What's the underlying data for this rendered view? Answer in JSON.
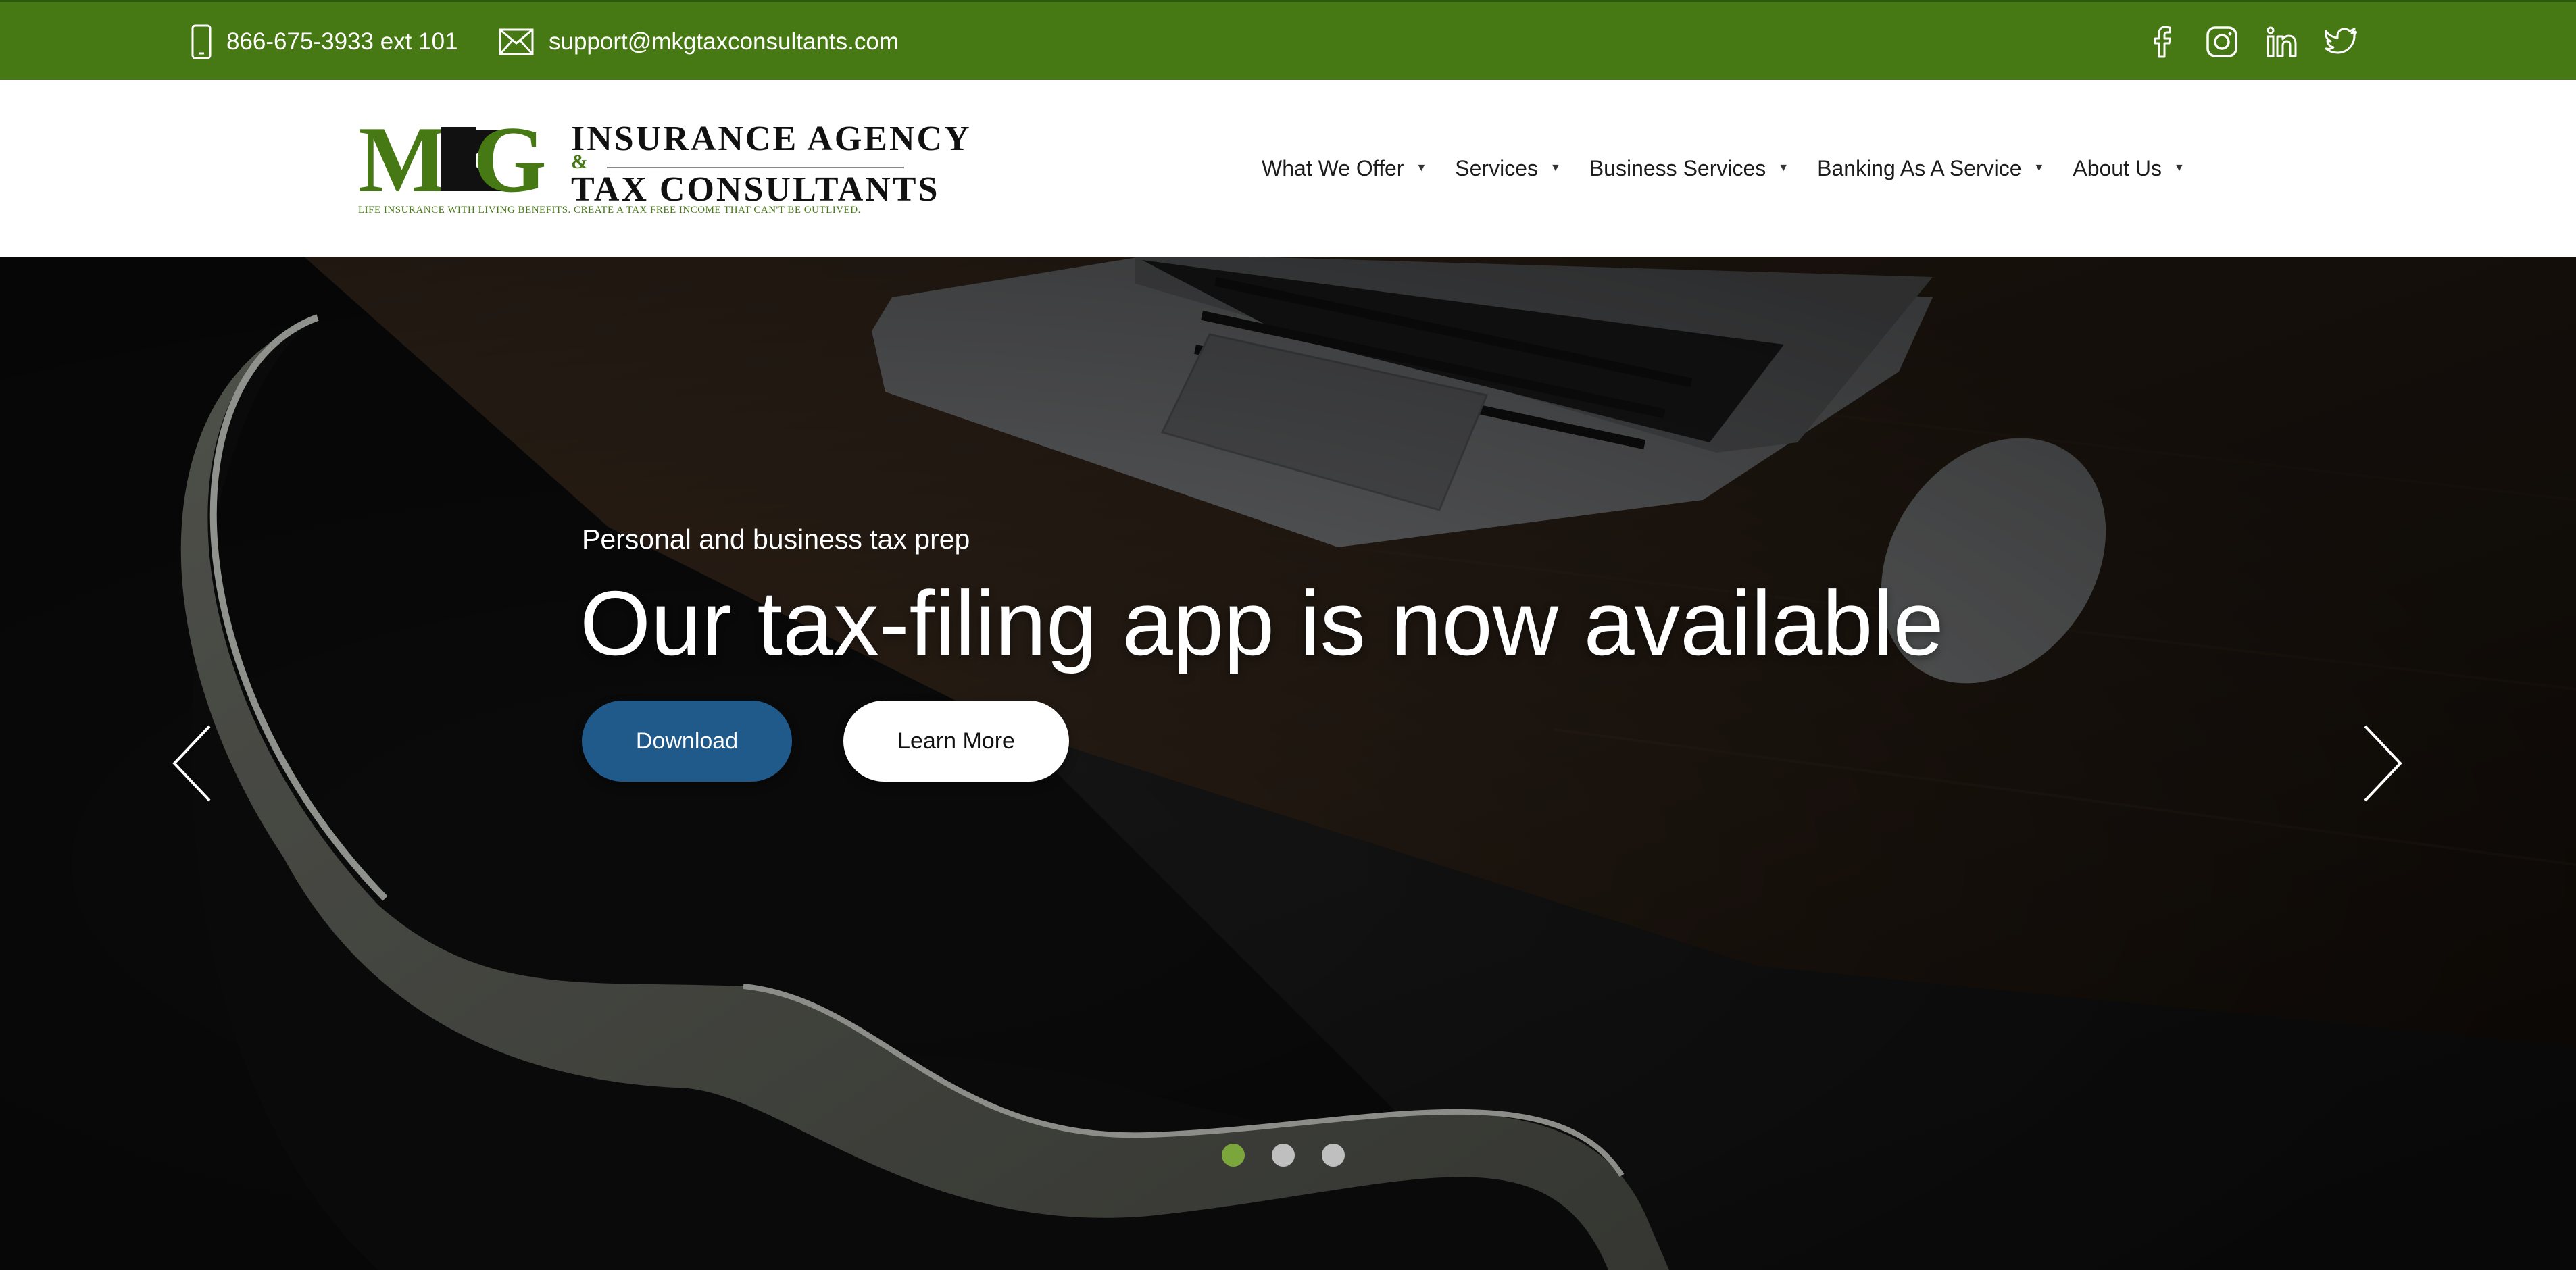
{
  "topbar": {
    "phone_icon": "mobile-phone-icon",
    "phone": "866-675-3933 ext 101",
    "email_icon": "envelope-icon",
    "email": "support@mkgtaxconsultants.com",
    "social_icons": [
      "facebook-icon",
      "instagram-icon",
      "linkedin-icon",
      "twitter-icon"
    ],
    "background_color": "#467813"
  },
  "logo": {
    "mark": "MKG",
    "line1": "INSURANCE AGENCY",
    "amp": "&",
    "line2": "TAX CONSULTANTS",
    "tagline": "LIFE INSURANCE WITH LIVING BENEFITS. CREATE A TAX FREE INCOME THAT CAN'T BE OUTLIVED."
  },
  "nav": {
    "items": [
      {
        "label": "What We Offer"
      },
      {
        "label": "Services"
      },
      {
        "label": "Business Services"
      },
      {
        "label": "Banking As A Service"
      },
      {
        "label": "About Us"
      }
    ]
  },
  "hero": {
    "subtitle": "Personal and business tax prep",
    "title": "Our tax-filing app is now available",
    "download_label": "Download",
    "learn_more_label": "Learn More",
    "slides_total": 3,
    "active_slide": 1,
    "download_color": "#1f5a8b"
  }
}
